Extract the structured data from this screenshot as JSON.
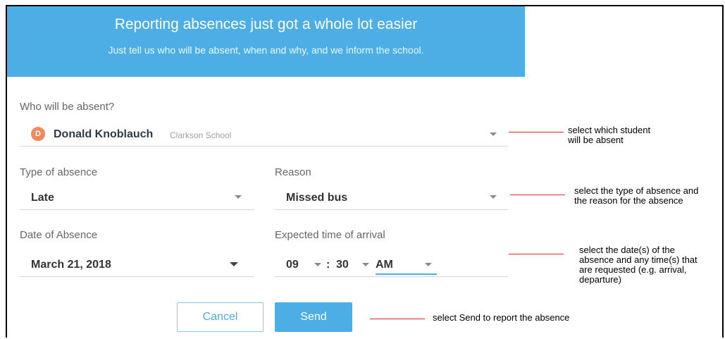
{
  "banner": {
    "title": "Reporting absences just got a whole lot easier",
    "subtitle": "Just tell us who will be absent, when and why, and we inform the school."
  },
  "student": {
    "label": "Who will be absent?",
    "avatar_initial": "D",
    "name": "Donald Knoblauch",
    "school": "Clarkson School"
  },
  "absence_type": {
    "label": "Type of absence",
    "value": "Late"
  },
  "reason": {
    "label": "Reason",
    "value": "Missed bus"
  },
  "date": {
    "label": "Date of Absence",
    "value": "March 21, 2018"
  },
  "arrival": {
    "label": "Expected time of arrival",
    "hour": "09",
    "separator": ":",
    "minute": "30",
    "period": "AM"
  },
  "buttons": {
    "cancel": "Cancel",
    "send": "Send"
  },
  "annotations": {
    "student": [
      "select which student",
      "will be absent"
    ],
    "type_reason": [
      "select the type of absence and",
      "the reason for the absence"
    ],
    "date_time": [
      "select the date(s) of the",
      "absence and any time(s) that",
      "are requested (e.g. arrival,",
      "departure)"
    ],
    "send": [
      "select Send to report the absence"
    ]
  },
  "colors": {
    "accent": "#4daee6",
    "avatar": "#ef8a5f",
    "annotation_line": "#d8262b"
  }
}
